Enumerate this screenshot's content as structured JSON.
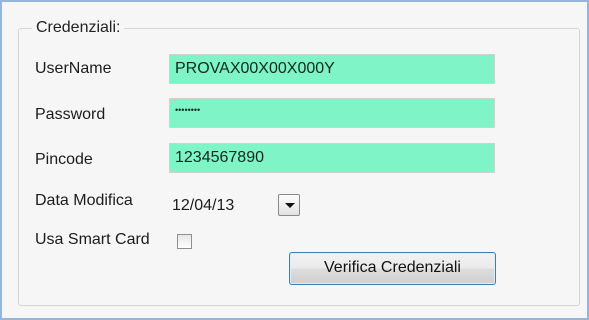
{
  "group": {
    "title": "Credenziali:"
  },
  "username": {
    "label": "UserName",
    "value": "PROVAX00X00X000Y"
  },
  "password": {
    "label": "Password",
    "value": "••••••••"
  },
  "pincode": {
    "label": "Pincode",
    "value": "1234567890"
  },
  "data_modifica": {
    "label": "Data Modifica",
    "value": "12/04/13"
  },
  "smart_card": {
    "label": "Usa Smart Card",
    "checked": false
  },
  "verify_button": {
    "label": "Verifica Credenziali"
  },
  "colors": {
    "field_background": "#7ff4c6",
    "window_border": "#97b5db",
    "button_focus_border": "#3c7fb1"
  }
}
